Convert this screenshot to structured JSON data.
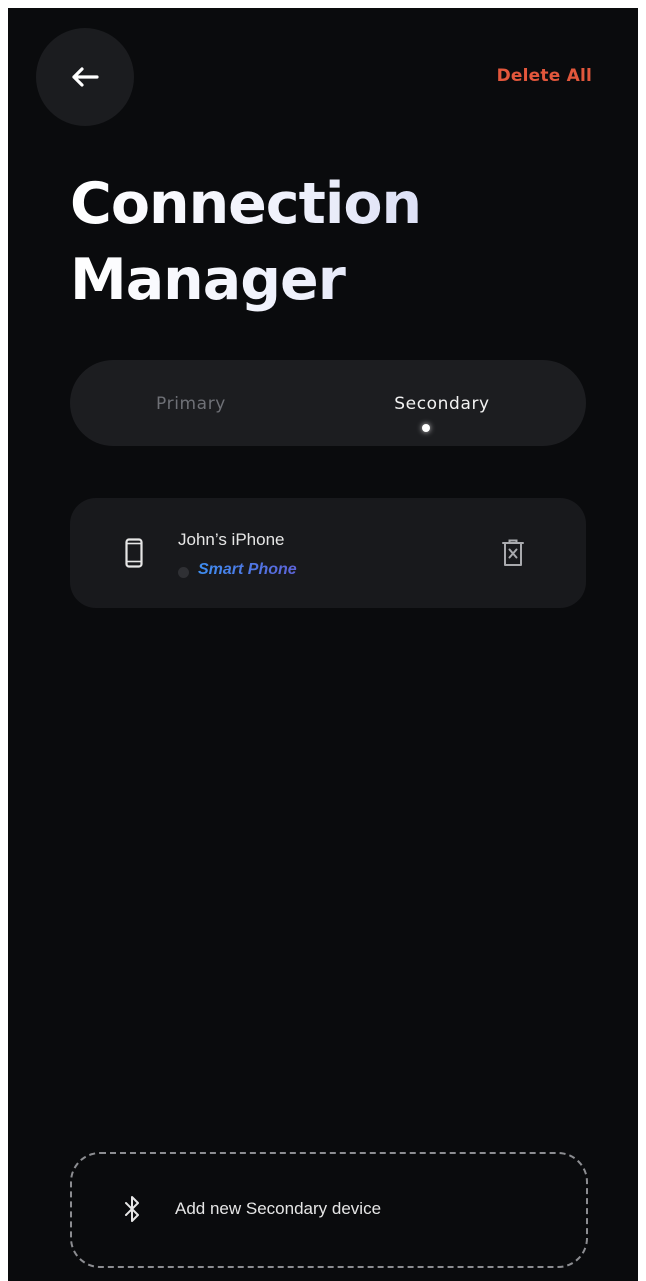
{
  "header": {
    "back_icon": "arrow-left-icon",
    "delete_all_label": "Delete All"
  },
  "title": {
    "line1": "Connection",
    "line2": "Manager"
  },
  "tabs": {
    "items": [
      {
        "label": "Primary",
        "active": false
      },
      {
        "label": "Secondary",
        "active": true
      }
    ]
  },
  "devices": [
    {
      "name": "John’s iPhone",
      "type": "Smart Phone",
      "icon": "smartphone-icon",
      "action_icon": "trash-icon"
    }
  ],
  "add_device": {
    "icon": "bluetooth-icon",
    "label": "Add new Secondary device"
  },
  "colors": {
    "background": "#0a0b0d",
    "card": "#18191c",
    "danger": "#e2573c",
    "accent_gradient_start": "#3e8ef1",
    "accent_gradient_end": "#5d63d8"
  }
}
